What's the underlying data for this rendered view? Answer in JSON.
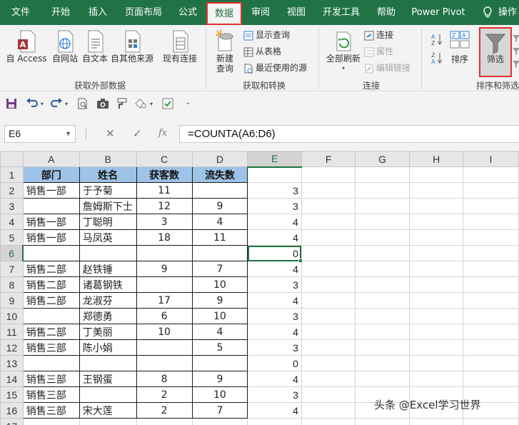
{
  "tabs": [
    {
      "label": "文件",
      "active": false
    },
    {
      "label": "开始",
      "active": false
    },
    {
      "label": "插入",
      "active": false
    },
    {
      "label": "页面布局",
      "active": false
    },
    {
      "label": "公式",
      "active": false
    },
    {
      "label": "数据",
      "active": true
    },
    {
      "label": "审阅",
      "active": false
    },
    {
      "label": "视图",
      "active": false
    },
    {
      "label": "开发工具",
      "active": false
    },
    {
      "label": "帮助",
      "active": false
    },
    {
      "label": "Power Pivot",
      "active": false
    },
    {
      "label": "操作",
      "active": false
    }
  ],
  "ribbon": {
    "external": {
      "access": "自 Access",
      "web": "自网站",
      "text": "自文本",
      "other": "自其他来源",
      "existing": "现有连接",
      "group": "获取外部数据"
    },
    "transform": {
      "new_query_1": "新建",
      "new_query_2": "查询",
      "show_queries": "显示查询",
      "from_table": "从表格",
      "recent_sources": "最近使用的源",
      "group": "获取和转换"
    },
    "connections": {
      "refresh_all": "全部刷新",
      "connections": "连接",
      "properties": "属性",
      "edit_links": "编辑链接",
      "group": "连接"
    },
    "sort_filter": {
      "sort": "排序",
      "filter": "筛选",
      "group": "排序和筛选"
    }
  },
  "formula_bar": {
    "name_box": "E6",
    "formula": "=COUNTA(A6:D6)"
  },
  "grid": {
    "columns": [
      "A",
      "B",
      "C",
      "D",
      "E",
      "F",
      "G",
      "H",
      "I"
    ],
    "active_cell": "E6",
    "header_row": [
      "部门",
      "姓名",
      "获客数",
      "流失数"
    ],
    "rows": [
      {
        "n": "2",
        "a": "销售一部",
        "b": "于予菊",
        "c": "11",
        "d": "",
        "e": "3"
      },
      {
        "n": "3",
        "a": "",
        "b": "詹姆斯下士",
        "c": "12",
        "d": "9",
        "e": "3"
      },
      {
        "n": "4",
        "a": "销售一部",
        "b": "丁聪明",
        "c": "3",
        "d": "4",
        "e": "4"
      },
      {
        "n": "5",
        "a": "销售一部",
        "b": "马凤英",
        "c": "18",
        "d": "11",
        "e": "4"
      },
      {
        "n": "6",
        "a": "",
        "b": "",
        "c": "",
        "d": "",
        "e": "0"
      },
      {
        "n": "7",
        "a": "销售二部",
        "b": "赵铁锤",
        "c": "9",
        "d": "7",
        "e": "4"
      },
      {
        "n": "8",
        "a": "销售二部",
        "b": "诸葛钢铁",
        "c": "",
        "d": "10",
        "e": "3"
      },
      {
        "n": "9",
        "a": "销售二部",
        "b": "龙淑芬",
        "c": "17",
        "d": "9",
        "e": "4"
      },
      {
        "n": "10",
        "a": "",
        "b": "郑德勇",
        "c": "6",
        "d": "10",
        "e": "3"
      },
      {
        "n": "11",
        "a": "销售二部",
        "b": "丁美丽",
        "c": "10",
        "d": "4",
        "e": "4"
      },
      {
        "n": "12",
        "a": "销售三部",
        "b": "陈小娟",
        "c": "",
        "d": "5",
        "e": "3"
      },
      {
        "n": "13",
        "a": "",
        "b": "",
        "c": "",
        "d": "",
        "e": "0"
      },
      {
        "n": "14",
        "a": "销售三部",
        "b": "王钢蛋",
        "c": "8",
        "d": "9",
        "e": "4"
      },
      {
        "n": "15",
        "a": "销售三部",
        "b": "",
        "c": "2",
        "d": "10",
        "e": "3"
      },
      {
        "n": "16",
        "a": "销售三部",
        "b": "宋大莲",
        "c": "2",
        "d": "7",
        "e": "4"
      },
      {
        "n": "17",
        "a": "",
        "b": "",
        "c": "",
        "d": "",
        "e": ""
      }
    ]
  },
  "watermark": "头条 @Excel学习世界",
  "colors": {
    "accent": "#217346",
    "header_fill": "#9dc3e6",
    "highlight": "#e03030"
  }
}
